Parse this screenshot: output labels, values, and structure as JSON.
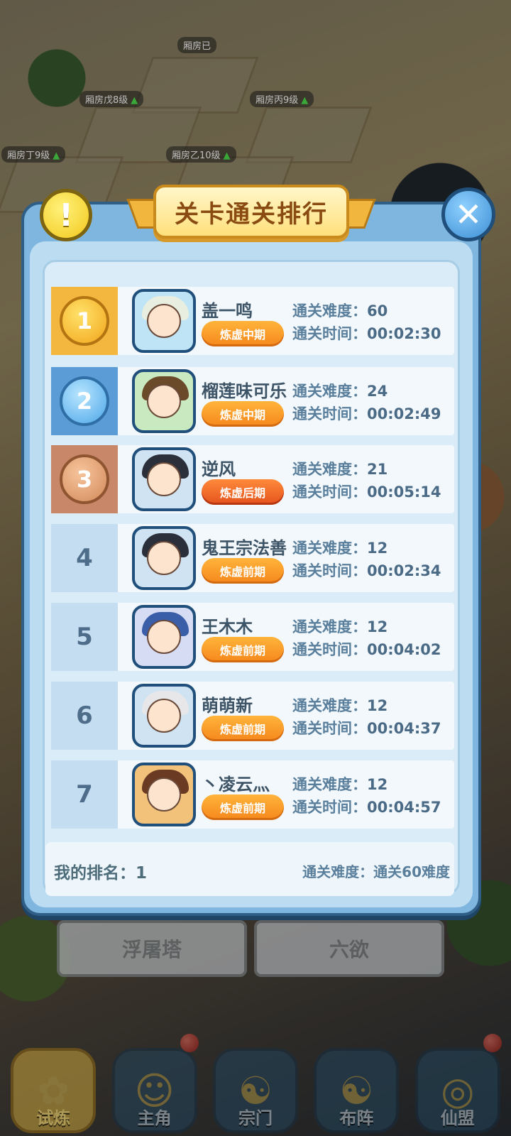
{
  "map_labels": [
    {
      "text": "厢房已",
      "up": false
    },
    {
      "text": "厢房戊8级",
      "up": true
    },
    {
      "text": "厢房丙9级",
      "up": true
    },
    {
      "text": "厢房丁9级",
      "up": true
    },
    {
      "text": "厢房乙10级",
      "up": true
    }
  ],
  "background_tabs": {
    "left": "浮屠塔",
    "right": "六欲"
  },
  "modal": {
    "title": "关卡通关排行",
    "warn_symbol": "!",
    "close_symbol": "✕",
    "rows": [
      {
        "rank": "1",
        "name": "盖一鸣",
        "realm": "炼虚中期",
        "difficulty_label": "通关难度：",
        "difficulty": "60",
        "time_label": "通关时间：",
        "time": "00:02:30"
      },
      {
        "rank": "2",
        "name": "榴莲味可乐",
        "realm": "炼虚中期",
        "difficulty_label": "通关难度：",
        "difficulty": "24",
        "time_label": "通关时间：",
        "time": "00:02:49"
      },
      {
        "rank": "3",
        "name": "逆风",
        "realm": "炼虚后期",
        "difficulty_label": "通关难度：",
        "difficulty": "21",
        "time_label": "通关时间：",
        "time": "00:05:14"
      },
      {
        "rank": "4",
        "name": "鬼王宗法善",
        "realm": "炼虚前期",
        "difficulty_label": "通关难度：",
        "difficulty": "12",
        "time_label": "通关时间：",
        "time": "00:02:34"
      },
      {
        "rank": "5",
        "name": "王木木",
        "realm": "炼虚前期",
        "difficulty_label": "通关难度：",
        "difficulty": "12",
        "time_label": "通关时间：",
        "time": "00:04:02"
      },
      {
        "rank": "6",
        "name": "萌萌新",
        "realm": "炼虚前期",
        "difficulty_label": "通关难度：",
        "difficulty": "12",
        "time_label": "通关时间：",
        "time": "00:04:37"
      },
      {
        "rank": "7",
        "name": "丶凌云灬",
        "realm": "炼虚前期",
        "difficulty_label": "通关难度：",
        "difficulty": "12",
        "time_label": "通关时间：",
        "time": "00:04:57"
      }
    ],
    "my_rank_label": "我的排名：1",
    "my_difficulty_label": "通关难度：通关60难度"
  },
  "bottom_nav": [
    {
      "label": "试炼",
      "icon": "trial-icon",
      "active": true
    },
    {
      "label": "主角",
      "icon": "hero-icon",
      "active": false
    },
    {
      "label": "宗门",
      "icon": "sect-icon",
      "active": false
    },
    {
      "label": "布阵",
      "icon": "formation-icon",
      "active": false
    },
    {
      "label": "仙盟",
      "icon": "alliance-icon",
      "active": false
    }
  ],
  "colors": {
    "gold": "#f2b632",
    "silver_blue": "#4da6e8",
    "bronze": "#d28a5a",
    "rank_cell_gold": "#f3b63f",
    "rank_cell_blue": "#5b9bd6",
    "rank_cell_bronze": "#c9876a",
    "rank_cell_plain": "#c5ddf0"
  }
}
